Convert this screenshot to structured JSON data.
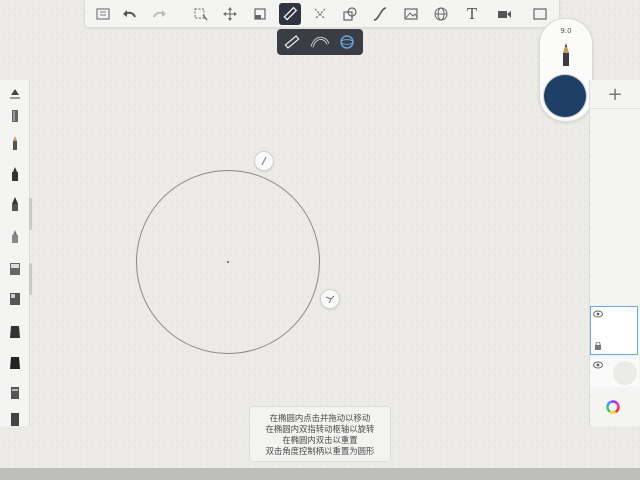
{
  "toolbar": {
    "tools": [
      {
        "name": "gallery-icon"
      },
      {
        "name": "undo-icon"
      },
      {
        "name": "redo-icon"
      },
      {
        "name": "select-icon"
      },
      {
        "name": "transform-icon"
      },
      {
        "name": "crop-icon"
      },
      {
        "name": "ruler-icon",
        "active": true
      },
      {
        "name": "symmetry-icon"
      },
      {
        "name": "fill-icon"
      },
      {
        "name": "curve-icon"
      },
      {
        "name": "image-import-icon"
      },
      {
        "name": "perspective-icon"
      },
      {
        "name": "text-tool-icon",
        "label": "T"
      },
      {
        "name": "video-icon"
      },
      {
        "name": "fullscreen-icon"
      }
    ]
  },
  "guide_subbar": {
    "tools": [
      {
        "name": "straight-ruler-icon"
      },
      {
        "name": "french-curve-icon"
      },
      {
        "name": "ellipse-guide-icon",
        "active": true
      }
    ]
  },
  "brush": {
    "size": "9.0",
    "color": "#1e3f66"
  },
  "left_panel": {
    "brushes": [
      "pencil-brush-icon",
      "pencil-brush-icon",
      "marker-brush-icon",
      "ink-pen-brush-icon",
      "fineliner-brush-icon",
      "airbrush-icon",
      "airbrush-icon",
      "chisel-brush-icon",
      "chisel-brush-icon",
      "paint-bucket-icon",
      "paint-bucket-icon"
    ]
  },
  "layers": {
    "add_label": "+"
  },
  "help": {
    "lines": [
      "在椭圆内点击并拖动以移动",
      "在椭圆内双指转动枢轴以旋转",
      "在椭圆内双击以重置",
      "双击角度控制柄以重置为圆形"
    ]
  },
  "colors": {
    "accent": "#1e3f66",
    "selected_layer": "#6aa8e0",
    "active_tool": "#2f3440"
  }
}
